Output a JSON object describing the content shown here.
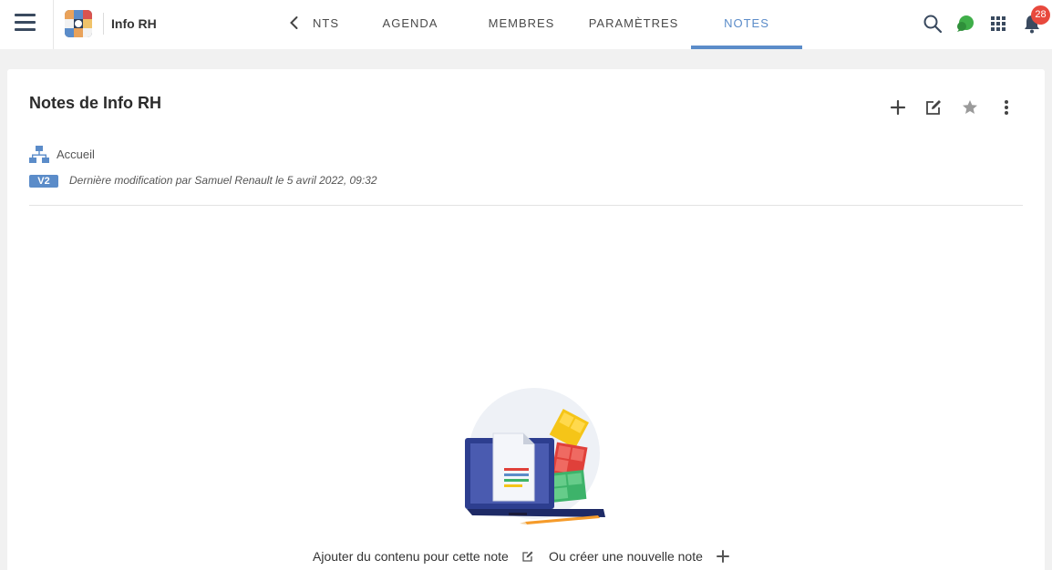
{
  "header": {
    "space_name": "Info RH",
    "tabs": [
      {
        "label": "NTS"
      },
      {
        "label": "AGENDA"
      },
      {
        "label": "MEMBRES"
      },
      {
        "label": "PARAMÈTRES"
      },
      {
        "label": "NOTES",
        "active": true
      }
    ],
    "notification_count": "28",
    "icons": [
      "menu-icon",
      "chevron-left-icon",
      "search-icon",
      "chat-icon",
      "apps-grid-icon",
      "bell-icon"
    ]
  },
  "page": {
    "title": "Notes de Info RH",
    "actions": [
      "add-icon",
      "edit-icon",
      "star-icon",
      "more-vertical-icon"
    ],
    "breadcrumb": "Accueil",
    "version": "V2",
    "last_modified": "Dernière modification par Samuel Renault le 5 avril 2022, 09:32"
  },
  "empty_state": {
    "add_content_text": "Ajouter du contenu pour cette note",
    "create_note_text": "Ou créer une nouvelle note"
  },
  "colors": {
    "accent": "#5b8cc9",
    "badge": "#e8493d",
    "chat": "#3fae49",
    "icon": "#3a4a5f"
  }
}
